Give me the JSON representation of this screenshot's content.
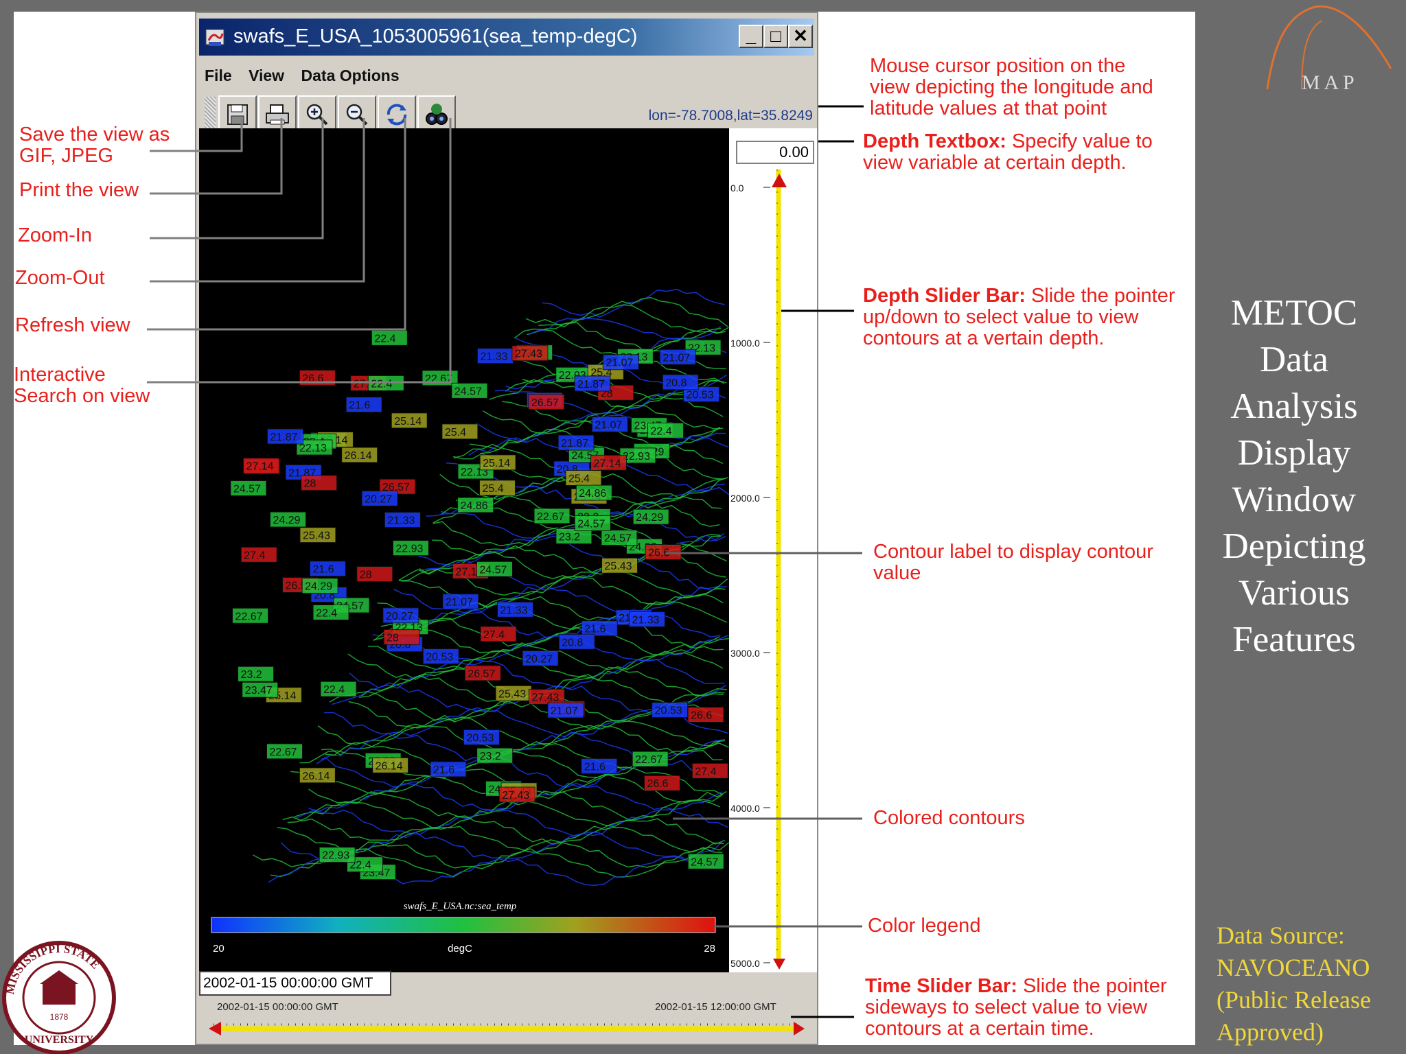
{
  "window": {
    "title": "swafs_E_USA_1053005961(sea_temp-degC)",
    "menu": [
      "File",
      "View",
      "Data Options"
    ],
    "coordinates_readout": "lon=-78.7008,lat=35.8249",
    "depth_value": "0.00",
    "time_value": "2002-01-15 00:00:00 GMT",
    "time_start": "2002-01-15 00:00:00 GMT",
    "time_end": "2002-01-15 12:00:00 GMT"
  },
  "toolbar": {
    "buttons": [
      {
        "name": "save-button",
        "icon": "floppy-disk-icon"
      },
      {
        "name": "print-button",
        "icon": "printer-icon"
      },
      {
        "name": "zoom-in-button",
        "icon": "zoom-in-icon"
      },
      {
        "name": "zoom-out-button",
        "icon": "zoom-out-icon"
      },
      {
        "name": "refresh-button",
        "icon": "refresh-icon"
      },
      {
        "name": "search-button",
        "icon": "binoculars-icon"
      }
    ]
  },
  "map": {
    "legend_title": "swafs_E_USA.nc:sea_temp",
    "legend_min": "20",
    "legend_unit": "degC",
    "legend_max": "28",
    "depth_ticks": [
      "0.0",
      "1000.0",
      "2000.0",
      "3000.0",
      "4000.0",
      "5000.0"
    ],
    "contour_labels": [
      "20.8",
      "22.13",
      "22.4",
      "21.87",
      "22.93",
      "21.6",
      "21.07",
      "22.67",
      "20.27",
      "20.53",
      "25.4",
      "28",
      "27.4",
      "26.6",
      "27.14",
      "26.57",
      "24.86",
      "24.57",
      "25.43",
      "24.29",
      "23.47",
      "22.4",
      "21.33",
      "23.2",
      "24.57",
      "26.14",
      "25.14",
      "27.43"
    ],
    "contour_colors": {
      "low": "#1a3cff",
      "mid": "#22c43a",
      "high": "#d01818"
    }
  },
  "annotations": {
    "save": [
      "Save the view as",
      "GIF, JPEG"
    ],
    "print": "Print the view",
    "zoom_in": "Zoom-In",
    "zoom_out": "Zoom-Out",
    "refresh": "Refresh view",
    "search": [
      "Interactive",
      "Search on view"
    ],
    "mouse": [
      "Mouse cursor position on the",
      "view depicting the longitude and",
      "latitude values at that point"
    ],
    "depth_textbox_bold": "Depth Textbox:",
    "depth_textbox": [
      "Specify value to",
      "view variable at certain depth."
    ],
    "depth_slider_bold": "Depth Slider Bar:",
    "depth_slider": [
      "Slide the pointer",
      "up/down to select value to view",
      "contours at a vertain depth."
    ],
    "contour_label": [
      "Contour label to display contour",
      "value"
    ],
    "colored_contours": "Colored contours",
    "color_legend": "Color legend",
    "time_slider_bold": "Time Slider Bar:",
    "time_slider": [
      "Slide the pointer",
      "sideways to select value to view",
      "contours at a certain time."
    ]
  },
  "side_title": [
    "METOC",
    "Data",
    "Analysis",
    "Display",
    "Window",
    "Depicting",
    "Various",
    "Features"
  ],
  "data_source": [
    "Data Source:",
    "NAVOCEANO",
    "(Public Release",
    "Approved)"
  ],
  "logo": {
    "map_letters": "M A P",
    "seal_text": "MISSISSIPPI STATE UNIVERSITY",
    "seal_year": "1878"
  },
  "colors": {
    "annotation_red": "#e8201c",
    "source_yellow": "#f1d83a",
    "slide_gray": "#6b6b6b"
  }
}
